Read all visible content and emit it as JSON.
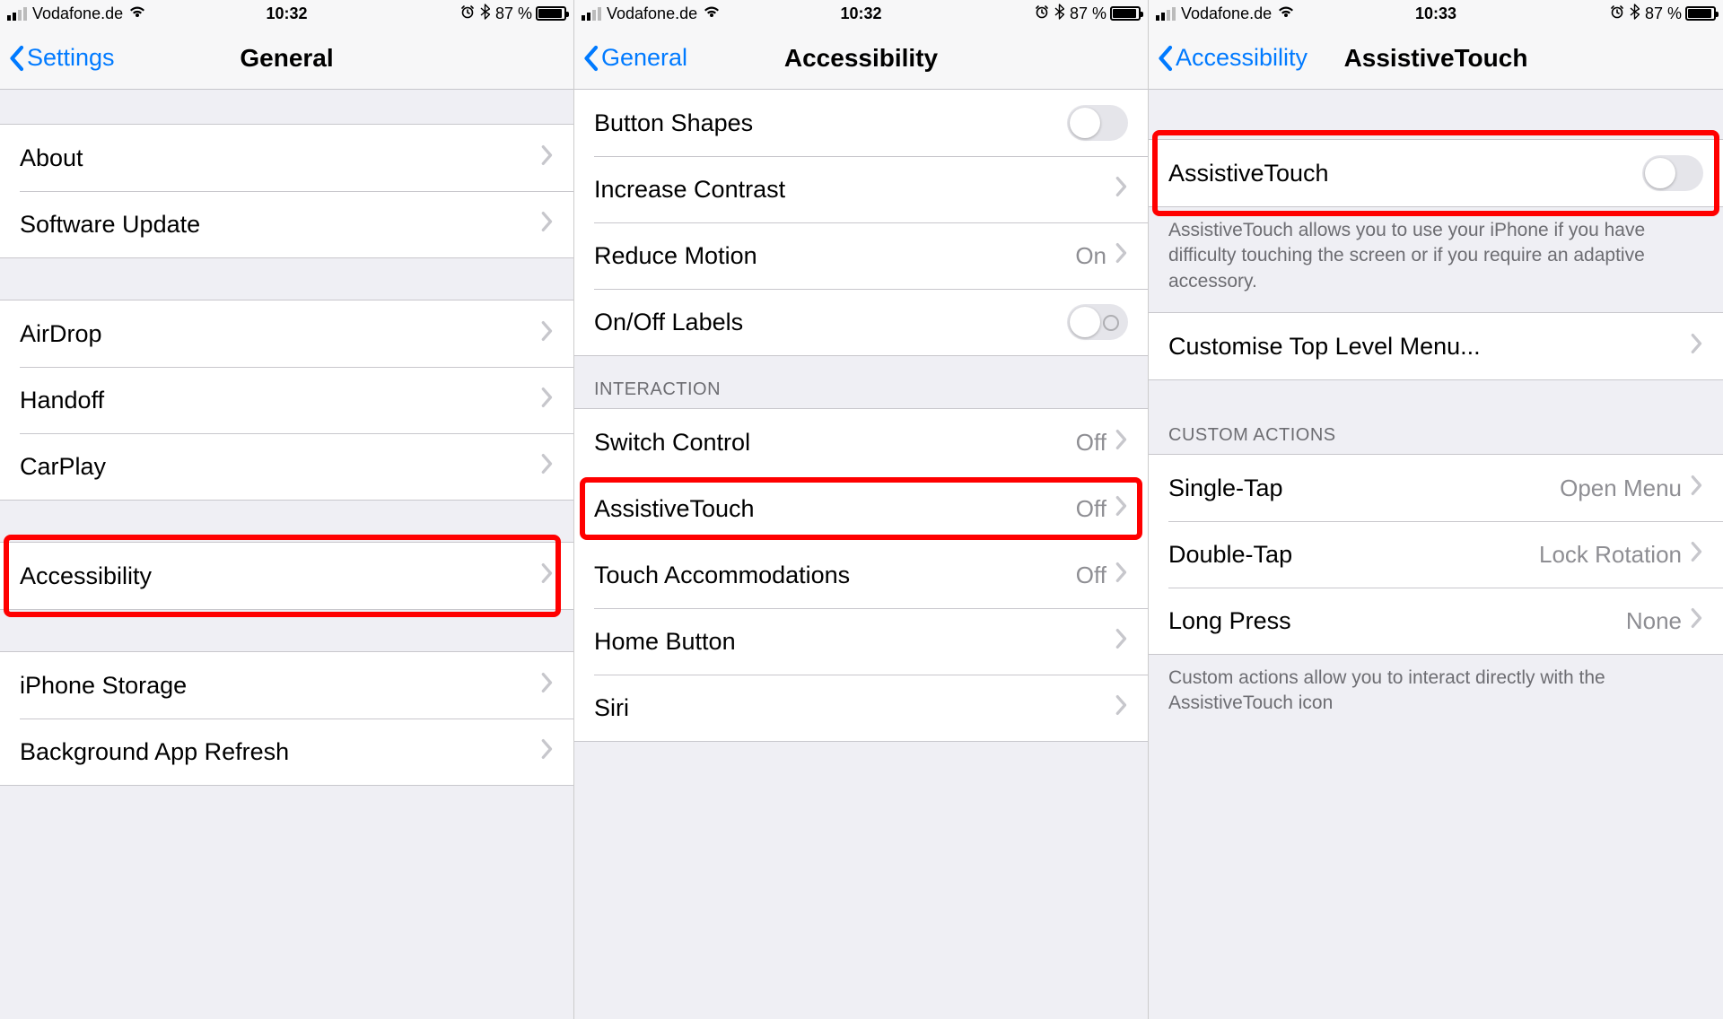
{
  "status": {
    "carrier": "Vodafone.de",
    "time_a": "10:32",
    "time_b": "10:32",
    "time_c": "10:33",
    "battery_pct": "87 %"
  },
  "screen1": {
    "back": "Settings",
    "title": "General",
    "rows": {
      "about": "About",
      "software_update": "Software Update",
      "airdrop": "AirDrop",
      "handoff": "Handoff",
      "carplay": "CarPlay",
      "accessibility": "Accessibility",
      "iphone_storage": "iPhone Storage",
      "background_app_refresh": "Background App Refresh"
    }
  },
  "screen2": {
    "back": "General",
    "title": "Accessibility",
    "rows": {
      "button_shapes": "Button Shapes",
      "increase_contrast": "Increase Contrast",
      "reduce_motion": "Reduce Motion",
      "reduce_motion_value": "On",
      "on_off_labels": "On/Off Labels",
      "interaction_header": "INTERACTION",
      "switch_control": "Switch Control",
      "switch_control_value": "Off",
      "assistive_touch": "AssistiveTouch",
      "assistive_touch_value": "Off",
      "touch_accommodations": "Touch Accommodations",
      "touch_accommodations_value": "Off",
      "home_button": "Home Button",
      "siri": "Siri"
    }
  },
  "screen3": {
    "back": "Accessibility",
    "title": "AssistiveTouch",
    "rows": {
      "assistive_touch": "AssistiveTouch",
      "description": "AssistiveTouch allows you to use your iPhone if you have difficulty touching the screen or if you require an adaptive accessory.",
      "customise": "Customise Top Level Menu...",
      "custom_actions_header": "CUSTOM ACTIONS",
      "single_tap": "Single-Tap",
      "single_tap_value": "Open Menu",
      "double_tap": "Double-Tap",
      "double_tap_value": "Lock Rotation",
      "long_press": "Long Press",
      "long_press_value": "None",
      "footer": "Custom actions allow you to interact directly with the AssistiveTouch icon"
    }
  }
}
